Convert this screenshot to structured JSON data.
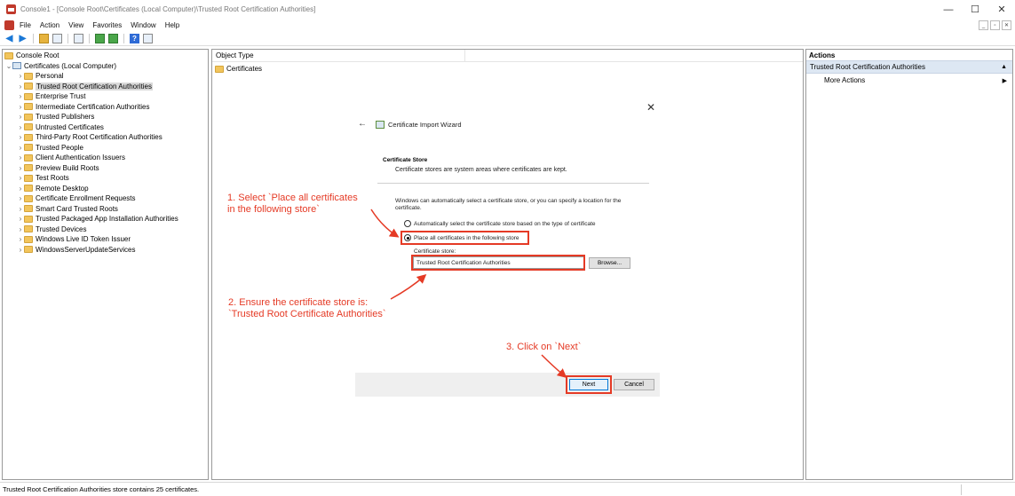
{
  "window": {
    "title": "Console1 - [Console Root\\Certificates (Local Computer)\\Trusted Root Certification Authorities]",
    "controls": {
      "minimize": "—",
      "maximize": "☐",
      "close": "✕"
    }
  },
  "menubar": {
    "items": [
      "File",
      "Action",
      "View",
      "Favorites",
      "Window",
      "Help"
    ],
    "mdi_controls": [
      "_",
      "▫",
      "✕"
    ]
  },
  "toolbar": {
    "icons": [
      "back-arrow-icon",
      "forward-arrow-icon",
      "up-folder-icon",
      "show-hide-tree-icon",
      "properties-icon",
      "refresh-icon",
      "export-list-icon",
      "help-icon",
      "console-tree-icon"
    ]
  },
  "tree": {
    "root": "Console Root",
    "certificates_node": "Certificates (Local Computer)",
    "items": [
      "Personal",
      "Trusted Root Certification Authorities",
      "Enterprise Trust",
      "Intermediate Certification Authorities",
      "Trusted Publishers",
      "Untrusted Certificates",
      "Third-Party Root Certification Authorities",
      "Trusted People",
      "Client Authentication Issuers",
      "Preview Build Roots",
      "Test Roots",
      "Remote Desktop",
      "Certificate Enrollment Requests",
      "Smart Card Trusted Roots",
      "Trusted Packaged App Installation Authorities",
      "Trusted Devices",
      "Windows Live ID Token Issuer",
      "WindowsServerUpdateServices"
    ],
    "selected": "Trusted Root Certification Authorities"
  },
  "center": {
    "column_header": "Object Type",
    "rows": [
      "Certificates"
    ]
  },
  "actions": {
    "title": "Actions",
    "section": "Trusted Root Certification Authorities",
    "more": "More Actions",
    "section_caret": "▲",
    "more_caret": "▶"
  },
  "wizard": {
    "close": "✕",
    "back": "←",
    "title": "Certificate Import Wizard",
    "heading": "Certificate Store",
    "subheading": "Certificate stores are system areas where certificates are kept.",
    "description": "Windows can automatically select a certificate store, or you can specify a location for the certificate.",
    "radio_auto": "Automatically select the certificate store based on the type of certificate",
    "radio_place": "Place all certificates in the following store",
    "store_label": "Certificate store:",
    "store_value": "Trusted Root Certification Authorities",
    "browse": "Browse...",
    "next": "Next",
    "cancel": "Cancel"
  },
  "annotations": {
    "step1_line1": "1. Select `Place all certificates",
    "step1_line2": "in the following store`",
    "step2_line1": "2. Ensure the certificate store is:",
    "step2_line2": "`Trusted Root Certificate Authorities`",
    "step3": "3. Click on `Next`",
    "color": "#e53a25"
  },
  "status": {
    "text": "Trusted Root Certification Authorities store contains 25 certificates."
  }
}
